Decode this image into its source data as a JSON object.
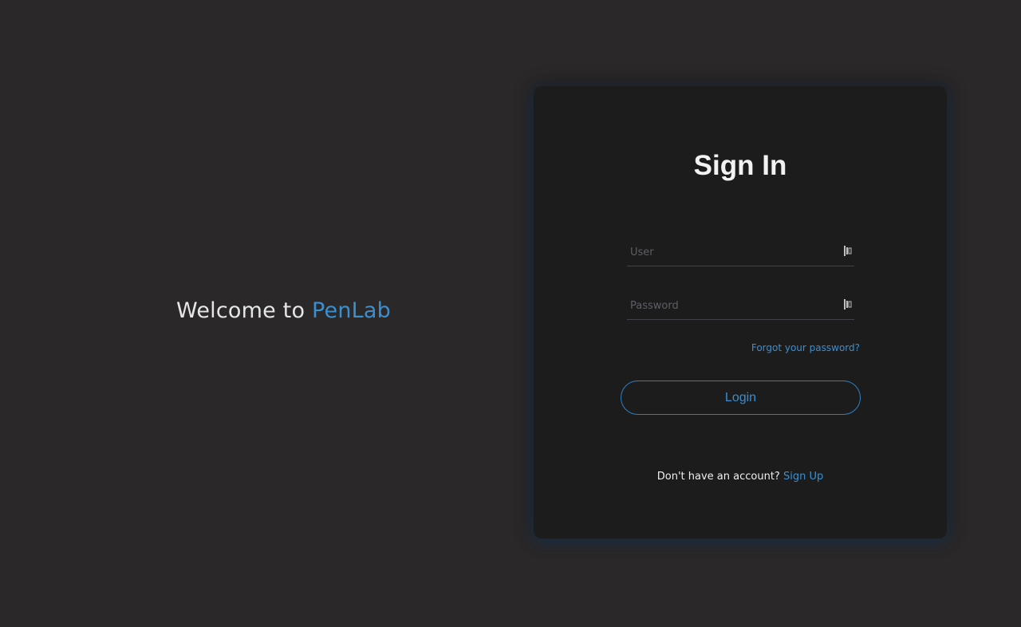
{
  "welcome": {
    "prefix": "Welcome to ",
    "brand": "PenLab"
  },
  "signin": {
    "title": "Sign In",
    "user_placeholder": "User",
    "password_placeholder": "Password",
    "forgot_label": "Forgot your password?",
    "login_label": "Login",
    "no_account_text": "Don't have an account? ",
    "signup_label": "Sign Up",
    "field_icon": "password-manager-icon"
  },
  "colors": {
    "background": "#2a2829",
    "card": "#1c1c1d",
    "accent": "#3a8fd1"
  }
}
